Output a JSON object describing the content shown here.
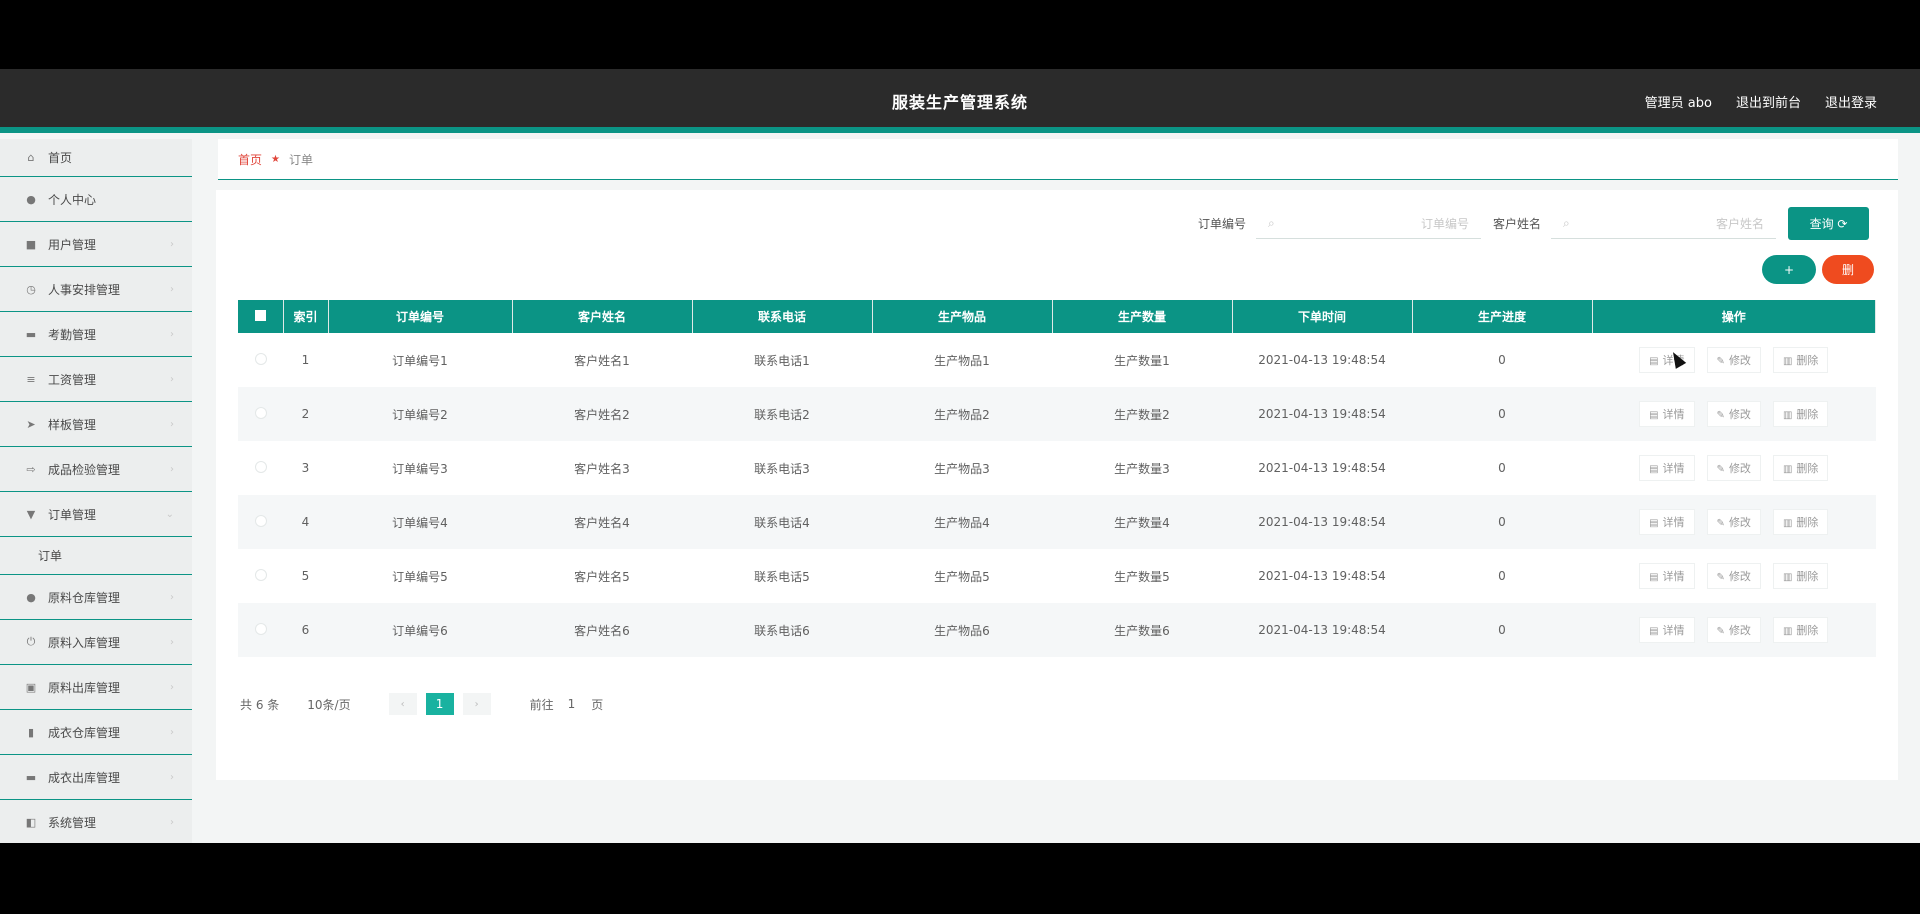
{
  "header": {
    "title": "服装生产管理系统",
    "user_label": "管理员 abo",
    "exit_front_label": "退出到前台",
    "logout_label": "退出登录"
  },
  "sidebar": {
    "items": [
      {
        "label": "首页",
        "icon": "home-icon"
      },
      {
        "label": "个人中心",
        "icon": "user-icon"
      },
      {
        "label": "用户管理",
        "icon": "users-icon"
      },
      {
        "label": "人事安排管理",
        "icon": "clock-icon"
      },
      {
        "label": "考勤管理",
        "icon": "attendance-icon"
      },
      {
        "label": "工资管理",
        "icon": "list-icon"
      },
      {
        "label": "样板管理",
        "icon": "sample-icon"
      },
      {
        "label": "成品检验管理",
        "icon": "inspect-icon"
      },
      {
        "label": "订单管理",
        "icon": "order-icon"
      },
      {
        "label": "原料仓库管理",
        "icon": "warehouse-icon"
      },
      {
        "label": "原料入库管理",
        "icon": "inbound-icon"
      },
      {
        "label": "原料出库管理",
        "icon": "outbound-icon"
      },
      {
        "label": "成衣仓库管理",
        "icon": "bar-chart-icon"
      },
      {
        "label": "成衣出库管理",
        "icon": "stock-out-icon"
      },
      {
        "label": "系统管理",
        "icon": "system-icon"
      }
    ],
    "submenu_label": "订单"
  },
  "breadcrumb": {
    "home": "首页",
    "current": "订单"
  },
  "search": {
    "order_no_label": "订单编号",
    "order_no_placeholder": "订单编号",
    "customer_label": "客户姓名",
    "customer_placeholder": "客户姓名",
    "query_button": "查询 ⟳"
  },
  "actions": {
    "add": "+",
    "delete": "删"
  },
  "table": {
    "headers": [
      "索引",
      "订单编号",
      "客户姓名",
      "联系电话",
      "生产物品",
      "生产数量",
      "下单时间",
      "生产进度",
      "操作"
    ],
    "rows": [
      [
        "1",
        "订单编号1",
        "客户姓名1",
        "联系电话1",
        "生产物品1",
        "生产数量1",
        "2021-04-13 19:48:54",
        "0"
      ],
      [
        "2",
        "订单编号2",
        "客户姓名2",
        "联系电话2",
        "生产物品2",
        "生产数量2",
        "2021-04-13 19:48:54",
        "0"
      ],
      [
        "3",
        "订单编号3",
        "客户姓名3",
        "联系电话3",
        "生产物品3",
        "生产数量3",
        "2021-04-13 19:48:54",
        "0"
      ],
      [
        "4",
        "订单编号4",
        "客户姓名4",
        "联系电话4",
        "生产物品4",
        "生产数量4",
        "2021-04-13 19:48:54",
        "0"
      ],
      [
        "5",
        "订单编号5",
        "客户姓名5",
        "联系电话5",
        "生产物品5",
        "生产数量5",
        "2021-04-13 19:48:54",
        "0"
      ],
      [
        "6",
        "订单编号6",
        "客户姓名6",
        "联系电话6",
        "生产物品6",
        "生产数量6",
        "2021-04-13 19:48:54",
        "0"
      ]
    ],
    "op_detail": "详情",
    "op_edit": "修改",
    "op_delete": "删除"
  },
  "pagination": {
    "total": "共 6 条",
    "page_size": "10条/页",
    "current_page": "1",
    "goto_label": "前往",
    "goto_value": "1",
    "page_unit": "页"
  },
  "colors": {
    "accent": "#0b9485",
    "danger": "#ef4b1f",
    "header_bg": "#2b2b2b"
  }
}
